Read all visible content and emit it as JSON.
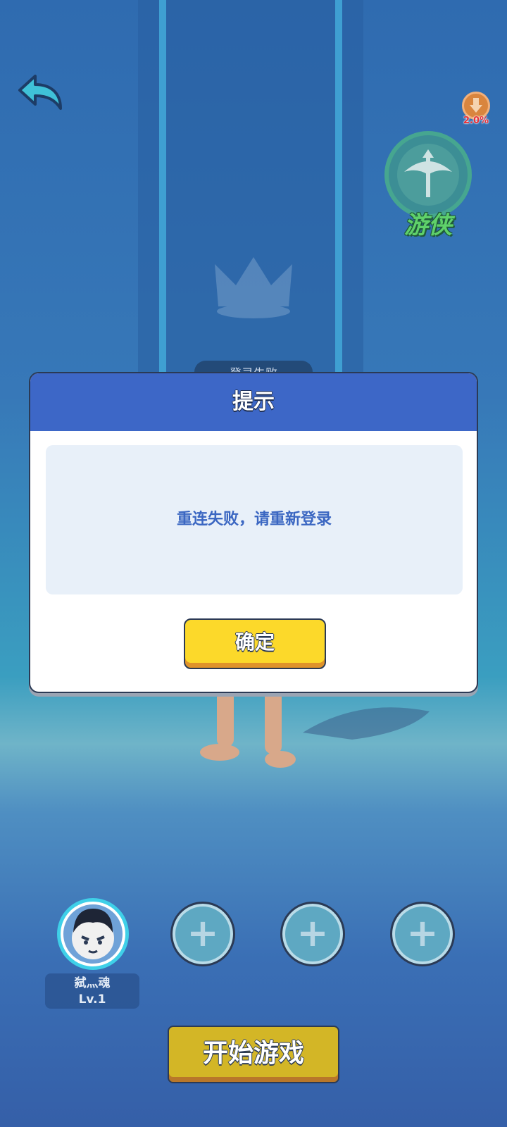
{
  "background": {
    "status_tab_label": "登录失败"
  },
  "header": {
    "back_icon": "back-arrow-icon",
    "percent_badge": "2.0%",
    "class_badge": {
      "name": "游侠",
      "icon": "crossbow-icon"
    }
  },
  "dialog": {
    "title": "提示",
    "message": "重连失败，请重新登录",
    "confirm_label": "确定"
  },
  "team": {
    "player": {
      "name": "弑灬魂",
      "level": "Lv.1"
    },
    "empty_slot_icon": "plus-icon",
    "empty_slots": [
      "+",
      "+",
      "+"
    ]
  },
  "start_button_label": "开始游戏",
  "colors": {
    "dialog_header": "#3d67c7",
    "confirm_button": "#fcd92a",
    "start_button": "#d3b626",
    "class_name": "#5fd16a"
  }
}
